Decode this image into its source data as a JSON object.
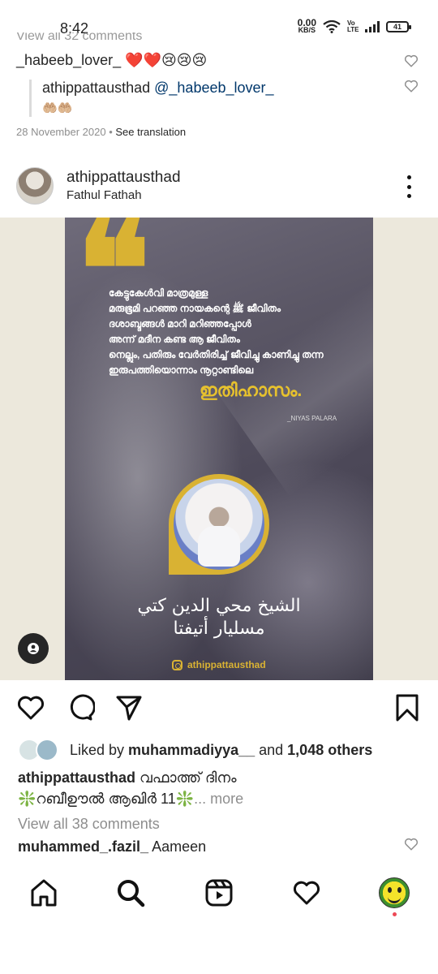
{
  "status_bar": {
    "time": "8:42",
    "net_speed": "0.00",
    "net_unit": "KB/S",
    "volte": "Vo LTE",
    "battery": "41"
  },
  "comments_top": {
    "cut_text": "View all 32 comments",
    "comment1": {
      "username": "_habeeb_lover_",
      "emojis": "❤️❤️😢😢😢"
    },
    "reply1": {
      "username": "athippattausthad",
      "mention": "@_habeeb_lover_",
      "emojis": "🤲🏼🤲🏼"
    },
    "date": "28 November 2020",
    "separator": " • ",
    "see_translation": "See translation"
  },
  "post": {
    "username": "athippattausthad",
    "location": "Fathul Fathah",
    "poster": {
      "quote": "❝",
      "malayalam_lines": [
        "കേട്ടുകേൾവി മാത്രമുള്ള",
        "മരുഭൂമി പറഞ്ഞ നായകന്റെ ﷺ ജീവിതം",
        "ദശാബ്ദങ്ങൾ മാറി മറിഞ്ഞപ്പോൾ",
        "അന്ന് മദീന കണ്ട ആ ജീവിതം",
        "നെല്ലും, പതിരും വേർതിരിച്ച് ജീവിച്ചു കാണിച്ചു തന്ന",
        "ഇരുപത്തിയൊന്നാം നൂറ്റാണ്ടിലെ"
      ],
      "headline": "ഇതിഹാസം.",
      "credit": "_NIYAS PALARA",
      "arabic_line1": "الشيخ محي الدين كتي",
      "arabic_line2": "مسليار أتيفتا",
      "handle": "athippattausthad"
    }
  },
  "likes": {
    "prefix": "Liked by ",
    "user": "muhammadiyya__",
    "middle": " and ",
    "others": "1,048 others"
  },
  "caption": {
    "username": "athippattausthad",
    "text1": " വഫാത്ത് ദിനം",
    "sparkle": "❇️",
    "text2": "റബീഊൽ ആഖിർ 11",
    "more": "... more"
  },
  "view_all": "View all 38 comments",
  "last_comment": {
    "username": "muhammed_.fazil_",
    "text": " Aameen"
  },
  "colors": {
    "accent_gold": "#d9b233",
    "link": "#00376b",
    "heart_red": "#ed4956"
  }
}
